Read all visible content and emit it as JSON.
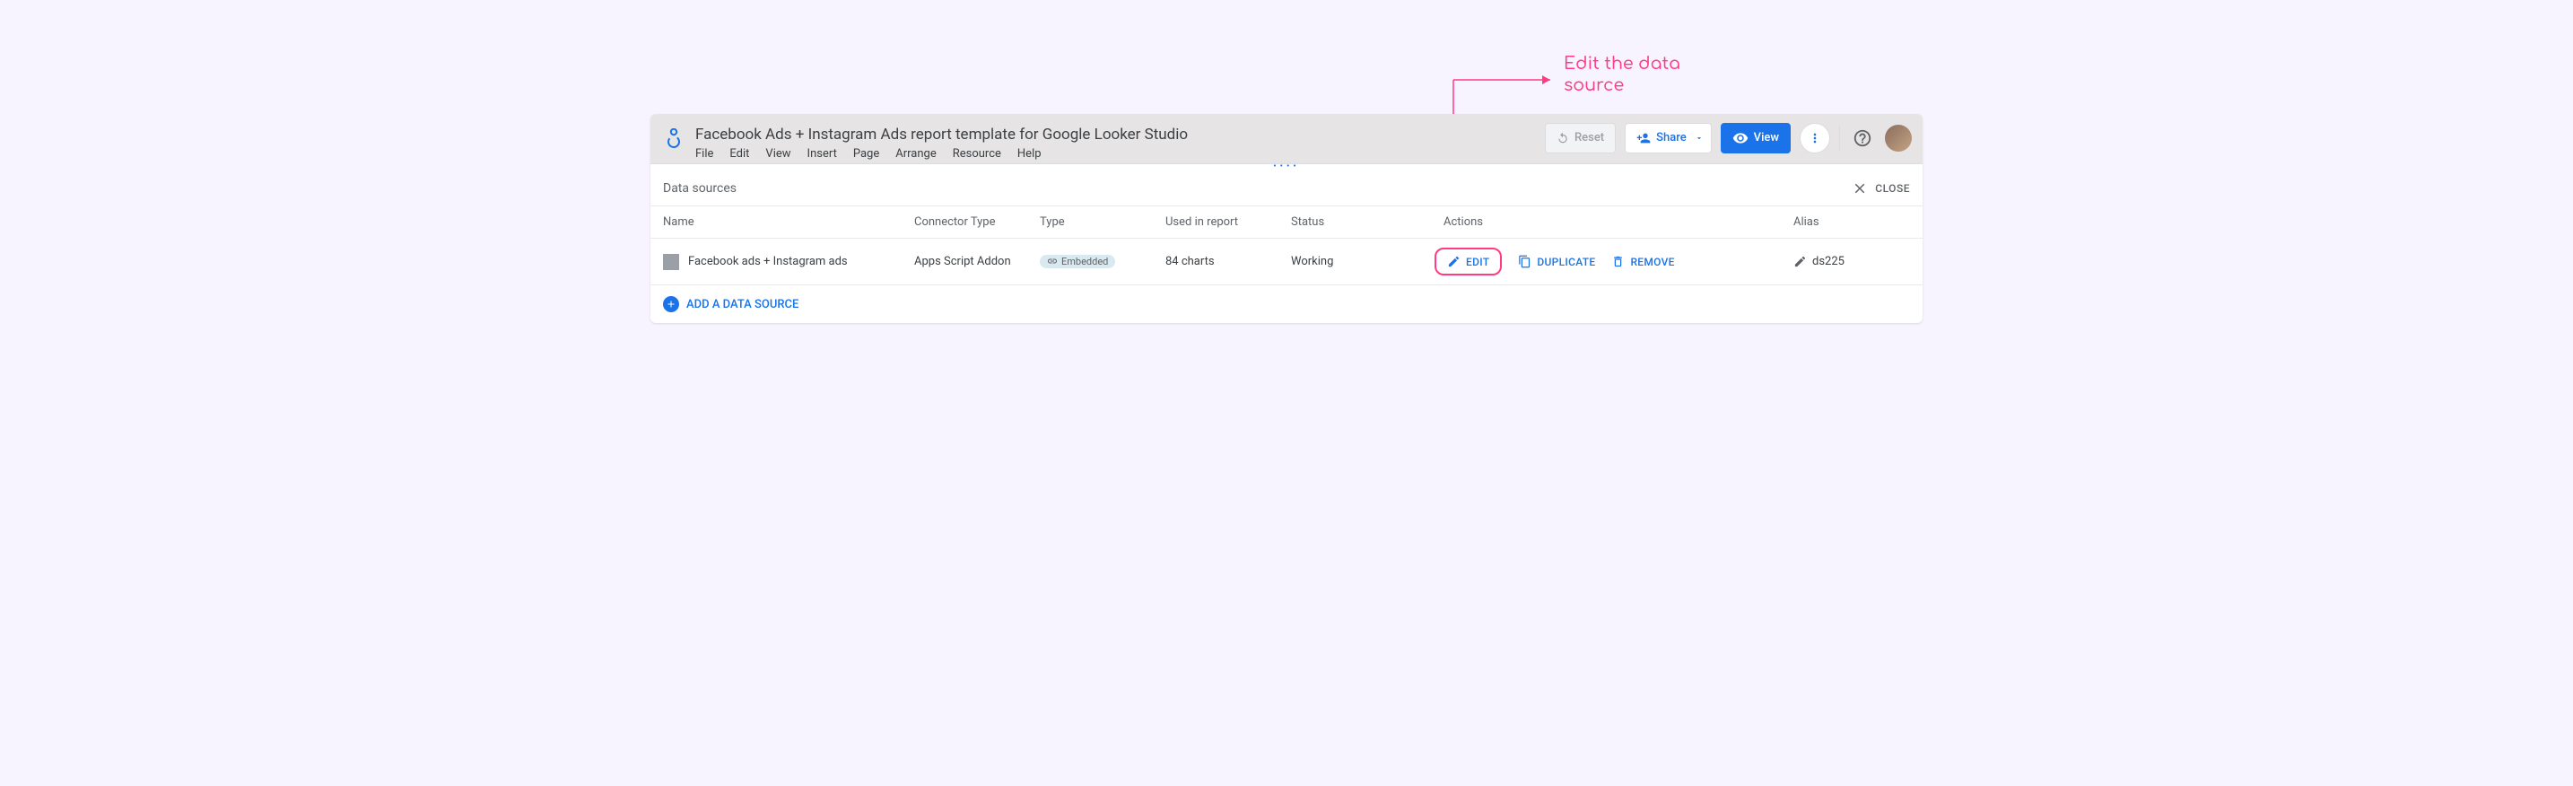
{
  "annotation": {
    "text": "Edit the data\nsource"
  },
  "toolbar": {
    "doc_title": "Facebook Ads + Instagram Ads report template for Google Looker Studio",
    "menu": [
      "File",
      "Edit",
      "View",
      "Insert",
      "Page",
      "Arrange",
      "Resource",
      "Help"
    ],
    "reset_label": "Reset",
    "share_label": "Share",
    "view_label": "View"
  },
  "panel": {
    "title": "Data sources",
    "close_label": "CLOSE"
  },
  "columns": {
    "name": "Name",
    "connector": "Connector Type",
    "type": "Type",
    "used": "Used in report",
    "status": "Status",
    "actions": "Actions",
    "alias": "Alias"
  },
  "row": {
    "name": "Facebook ads + Instagram ads",
    "connector": "Apps Script Addon",
    "type_chip": "Embedded",
    "used": "84 charts",
    "status": "Working",
    "edit": "EDIT",
    "duplicate": "DUPLICATE",
    "remove": "REMOVE",
    "alias": "ds225"
  },
  "add_label": "ADD A DATA SOURCE"
}
